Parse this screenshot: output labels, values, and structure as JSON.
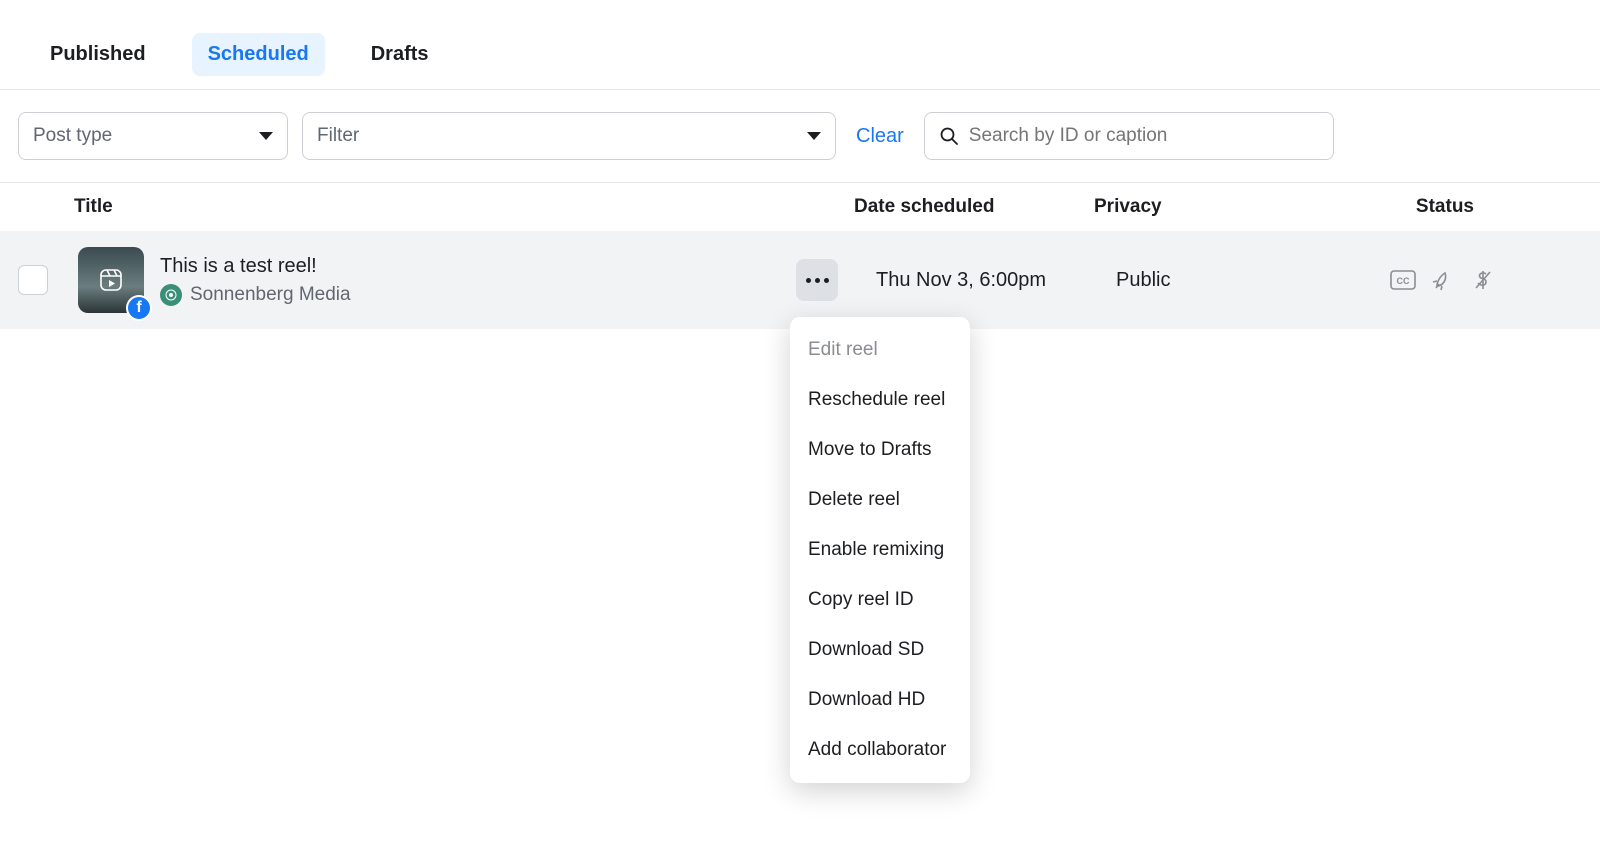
{
  "tabs": {
    "published": "Published",
    "scheduled": "Scheduled",
    "drafts": "Drafts",
    "active": "scheduled"
  },
  "filters": {
    "post_type_label": "Post type",
    "filter_label": "Filter",
    "clear_label": "Clear",
    "search_placeholder": "Search by ID or caption"
  },
  "columns": {
    "title": "Title",
    "date": "Date scheduled",
    "privacy": "Privacy",
    "status": "Status"
  },
  "row": {
    "title": "This is a test reel!",
    "author": "Sonnenberg Media",
    "date": "Thu Nov 3, 6:00pm",
    "privacy": "Public",
    "platform_badge": "f"
  },
  "menu": {
    "edit": "Edit reel",
    "reschedule": "Reschedule reel",
    "move_drafts": "Move to Drafts",
    "delete": "Delete reel",
    "enable_remix": "Enable remixing",
    "copy_id": "Copy reel ID",
    "download_sd": "Download SD",
    "download_hd": "Download HD",
    "add_collab": "Add collaborator"
  },
  "icons": {
    "cc": "closed-captions-icon",
    "boost": "rocket-icon",
    "monetize": "dollar-icon"
  }
}
